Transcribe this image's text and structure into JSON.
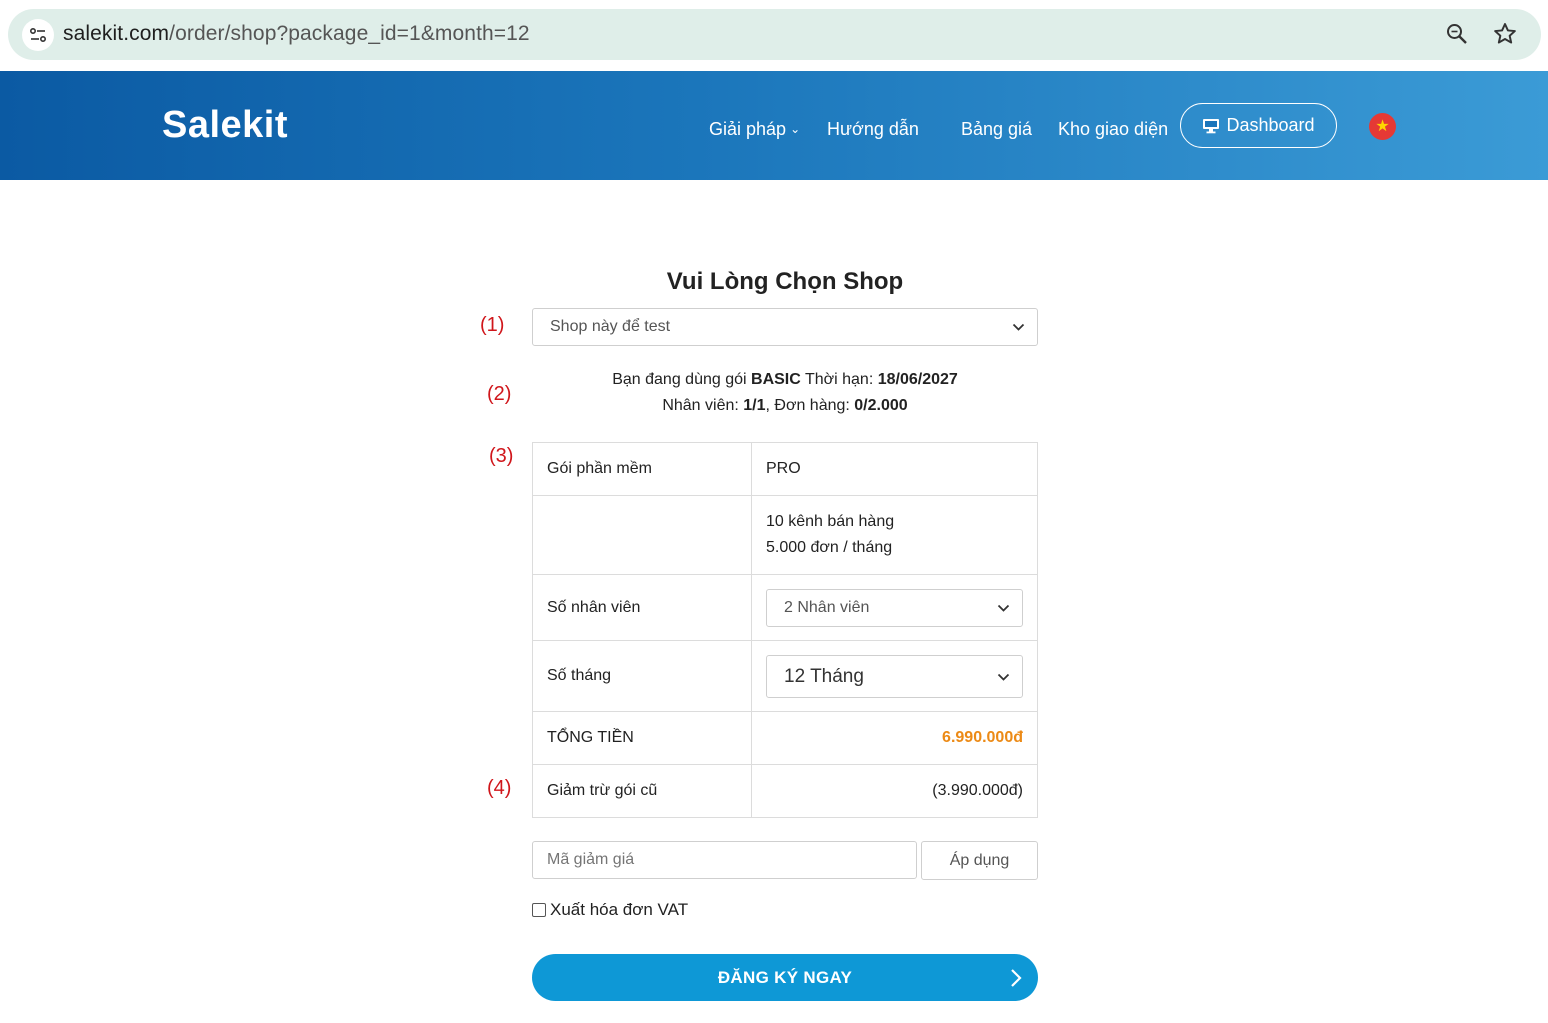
{
  "browser": {
    "url_host": "salekit.com",
    "url_path": "/order/shop?package_id=1&month=12"
  },
  "header": {
    "logo": "Salekit",
    "nav": [
      "Giải pháp",
      "Hướng dẫn",
      "Bảng giá",
      "Kho giao diện"
    ],
    "dashboard_label": "Dashboard",
    "flag_symbol": "★"
  },
  "main": {
    "title": "Vui Lòng Chọn Shop",
    "shop_select": "Shop này để test",
    "markers": [
      "(1)",
      "(2)",
      "(3)",
      "(4)"
    ],
    "current": {
      "line1_pre": "Bạn đang dùng gói ",
      "plan": "BASIC",
      "line1_mid": " Thời hạn: ",
      "expiry": "18/06/2027",
      "staff_label": "Nhân viên: ",
      "staff_value": "1/1",
      "orders_label": ", Đơn hàng: ",
      "orders_value": "0/2.000"
    },
    "table": {
      "package_label": "Gói phần mềm",
      "package_value": "PRO",
      "feature_1": "10 kênh bán hàng",
      "feature_2": "5.000 đơn / tháng",
      "staff_label": "Số nhân viên",
      "staff_select": "2 Nhân viên",
      "months_label": "Số tháng",
      "months_select": "12 Tháng",
      "total_label": "TỔNG TIỀN",
      "total_value": "6.990.000đ",
      "discount_label": "Giảm trừ gói cũ",
      "discount_value": "(3.990.000đ)"
    },
    "coupon_placeholder": "Mã giảm giá",
    "apply_label": "Áp dụng",
    "vat_label": "Xuất hóa đơn VAT",
    "submit_label": "ĐĂNG KÝ NGAY"
  },
  "colors": {
    "header_start": "#0b5aa3",
    "header_end": "#3b9bd6",
    "price": "#ec8a16",
    "submit": "#0e98d6",
    "marker": "#d0161b"
  }
}
